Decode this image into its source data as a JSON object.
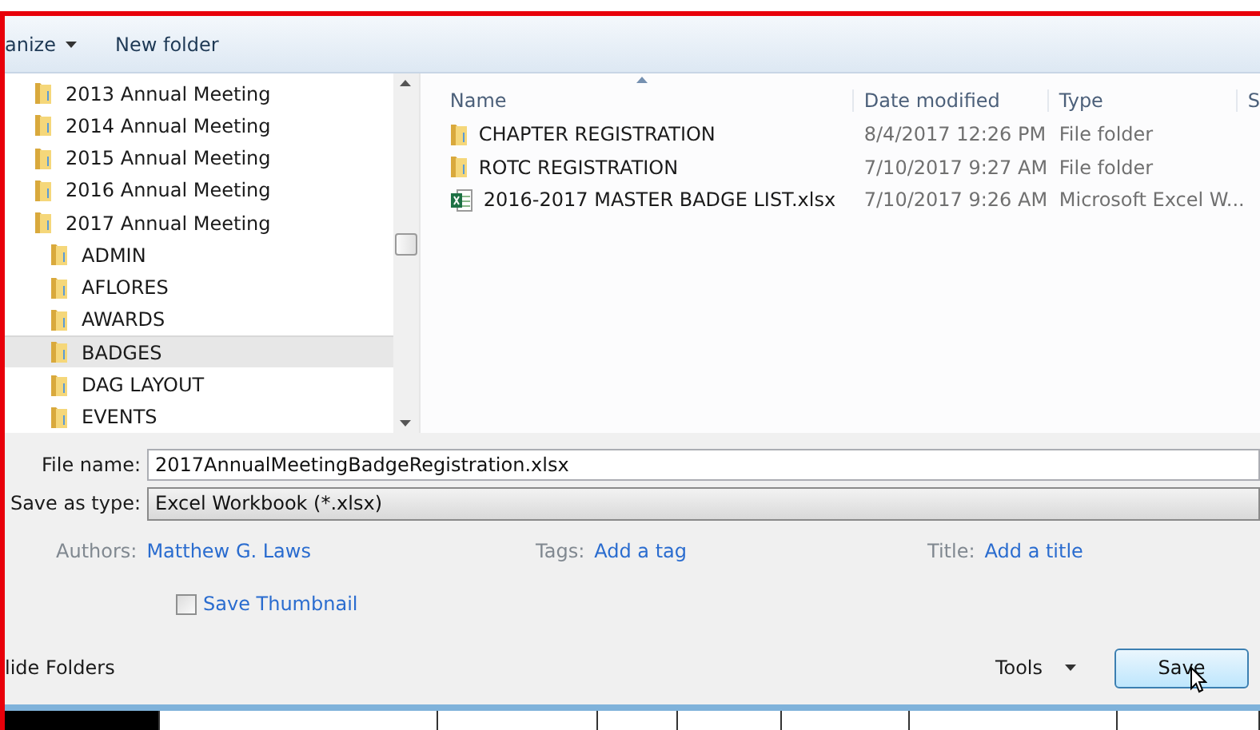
{
  "toolbar": {
    "organize": "anize",
    "new_folder": "New folder"
  },
  "nav_tree": [
    {
      "label": "2013 Annual Meeting",
      "selected": false
    },
    {
      "label": "2014 Annual Meeting",
      "selected": false
    },
    {
      "label": "2015 Annual Meeting",
      "selected": false
    },
    {
      "label": "2016 Annual Meeting",
      "selected": false
    },
    {
      "label": "2017 Annual Meeting",
      "selected": false,
      "children": [
        {
          "label": "ADMIN",
          "selected": false
        },
        {
          "label": "AFLORES",
          "selected": false
        },
        {
          "label": "AWARDS",
          "selected": false
        },
        {
          "label": "BADGES",
          "selected": true
        },
        {
          "label": "DAG LAYOUT",
          "selected": false
        },
        {
          "label": "EVENTS",
          "selected": false
        }
      ]
    }
  ],
  "file_list": {
    "columns": [
      "Name",
      "Date modified",
      "Type",
      "S"
    ],
    "rows": [
      {
        "kind": "folder",
        "name": "CHAPTER REGISTRATION",
        "date": "8/4/2017 12:26 PM",
        "type": "File folder"
      },
      {
        "kind": "folder",
        "name": "ROTC REGISTRATION",
        "date": "7/10/2017 9:27 AM",
        "type": "File folder"
      },
      {
        "kind": "excel",
        "name": "2016-2017 MASTER BADGE LIST.xlsx",
        "date": "7/10/2017 9:26 AM",
        "type": "Microsoft Excel W..."
      }
    ]
  },
  "form": {
    "file_name_label": "File name:",
    "file_name": "2017AnnualMeetingBadgeRegistration.xlsx",
    "type_label": "Save as type:",
    "type_value": "Excel Workbook (*.xlsx)",
    "meta": [
      {
        "label": "Authors:",
        "value": "Matthew G. Laws"
      },
      {
        "label": "Tags:",
        "value": "Add a tag"
      },
      {
        "label": "Title:",
        "value": "Add a title"
      }
    ],
    "thumbnail": {
      "label": "Save Thumbnail",
      "checked": false
    }
  },
  "footer": {
    "hide_folders": "lide Folders",
    "tools": "Tools",
    "save": "Save"
  }
}
